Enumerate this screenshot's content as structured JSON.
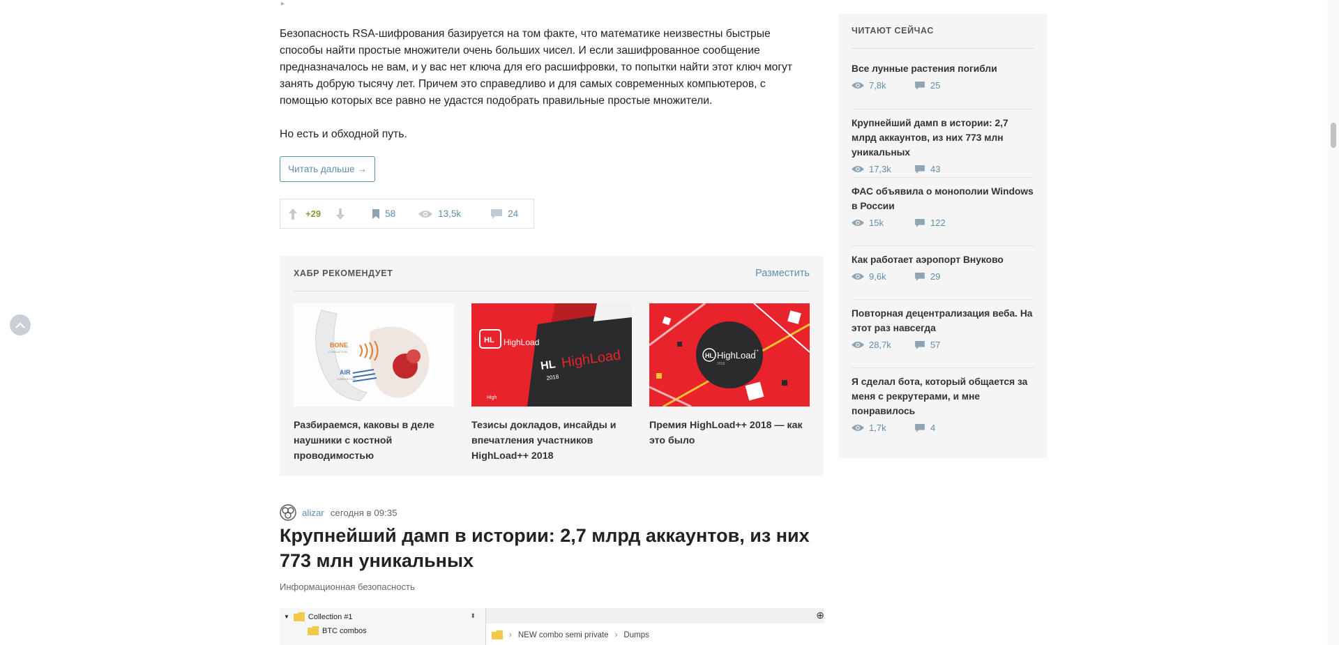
{
  "post": {
    "paragraphs": [
      "Безопасность RSA-шифрования базируется на том факте, что математике неизвестны быстрые способы найти простые множители очень больших чисел. И если зашифрованное сообщение предназначалось не вам, и у вас нет ключа для его расшифровки, то попытки найти этот ключ могут занять добрую тысячу лет. Причем это справедливо и для самых современных компьютеров, с помощью которых все равно не удастся подобрать правильные простые множители.",
      "Но есть и обходной путь."
    ],
    "read_more_label": "Читать дальше →",
    "stats": {
      "score": "+29",
      "bookmarks": "58",
      "views": "13,5k",
      "comments": "24"
    }
  },
  "recommend": {
    "title": "ХАБР РЕКОМЕНДУЕТ",
    "place_label": "Разместить",
    "cards": [
      {
        "caption": "Разбираемся, каковы в деле наушники с костной проводимостью",
        "image": "bone-conduction-headphones-image",
        "img_text_1": "BONE",
        "img_text_1b": "CONDUCTION",
        "img_text_2": "AIR",
        "img_text_2b": "CONDUCTION"
      },
      {
        "caption": "Тезисы докладов, инсайды и впечатления участников HighLoad++ 2018",
        "image": "highload-stage-photo",
        "img_text_1": "HL",
        "img_text_2": "HighLoad",
        "img_text_3": "2018",
        "img_text_4": "High"
      },
      {
        "caption": "Премия HighLoad++ 2018 — как это было",
        "image": "highload-logo-graphic",
        "img_text_1": "HL",
        "img_text_2": "HighLoad",
        "img_text_3": "++",
        "img_text_4": "2018"
      }
    ]
  },
  "next_post": {
    "author": "alizar",
    "time": "сегодня в 09:35",
    "title": "Крупнейший дамп в истории: 2,7 млрд аккаунтов, из них 773 млн уникальных",
    "hub": "Информационная безопасность",
    "screenshot": {
      "tree_items": [
        "Collection #1",
        "BTC combos"
      ],
      "breadcrumb": [
        "NEW combo semi private",
        "Dumps"
      ]
    }
  },
  "sidebar": {
    "title": "ЧИТАЮТ СЕЙЧАС",
    "items": [
      {
        "title": "Все лунные растения погибли",
        "views": "7,8k",
        "comments": "25"
      },
      {
        "title": "Крупнейший дамп в истории: 2,7 млрд аккаунтов, из них 773 млн уникальных",
        "views": "17,3k",
        "comments": "43"
      },
      {
        "title": "ФАС объявила о монополии Windows в России",
        "views": "15k",
        "comments": "122"
      },
      {
        "title": "Как работает аэропорт Внуково",
        "views": "9,6k",
        "comments": "29"
      },
      {
        "title": "Повторная децентрализация веба. На этот раз навсегда",
        "views": "28,7k",
        "comments": "57"
      },
      {
        "title": "Я сделал бота, который общается за меня с рекрутерами, и мне понравилось",
        "views": "1,7k",
        "comments": "4"
      }
    ]
  },
  "colors": {
    "link": "#5e8eac",
    "score_positive": "#7ba030",
    "block_bg": "#f5f5f5",
    "highload_red": "#e8232b"
  }
}
